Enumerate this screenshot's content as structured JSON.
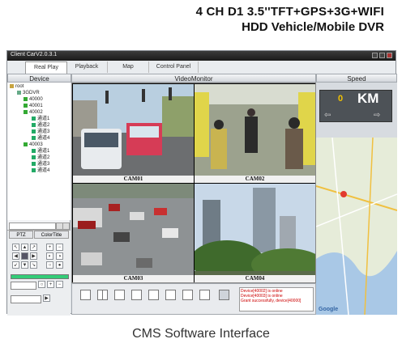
{
  "headline": {
    "line1": "4 CH D1 3.5''TFT+GPS+3G+WIFI",
    "line2": "HDD Vehicle/Mobile DVR"
  },
  "caption": "CMS Software Interface",
  "app": {
    "title": "Client CarV2.0.3.1",
    "tabs": [
      "Real Play",
      "Playback",
      "Map",
      "Control Panel"
    ],
    "active_tab": "Real Play"
  },
  "panels": {
    "device": "Device",
    "video": "VideoMonitor",
    "speed": "Speed"
  },
  "device_tree": [
    {
      "label": "root"
    },
    {
      "label": "3GDVR"
    },
    {
      "label": "40000"
    },
    {
      "label": "40001"
    },
    {
      "label": "40002"
    },
    {
      "label": "通道1"
    },
    {
      "label": "通道2"
    },
    {
      "label": "通道3"
    },
    {
      "label": "通道4"
    },
    {
      "label": "40003"
    },
    {
      "label": "通道1"
    },
    {
      "label": "通道2"
    },
    {
      "label": "通道3"
    },
    {
      "label": "通道4"
    }
  ],
  "ptz_tabs": [
    "PTZ",
    "ColorTitle"
  ],
  "cameras": [
    {
      "label": "CAM01"
    },
    {
      "label": "CAM02"
    },
    {
      "label": "CAM03"
    },
    {
      "label": "CAM04"
    }
  ],
  "status_log": [
    "Device[40002] is online",
    "Device[40003] is online",
    "Grant successfully, device[40000]"
  ],
  "speed": {
    "value": "0",
    "unit": "KM"
  },
  "map": {
    "provider": "Google"
  },
  "colors": {
    "titlebar": "#1a1a1a",
    "panel_bg": "#dfe3e8",
    "status_text": "#cc0000",
    "speed_value": "#f2c200"
  },
  "icons": [
    "left-arrow-icon",
    "right-arrow-icon",
    "map-pin-icon",
    "folder-icon",
    "camera-icon"
  ]
}
